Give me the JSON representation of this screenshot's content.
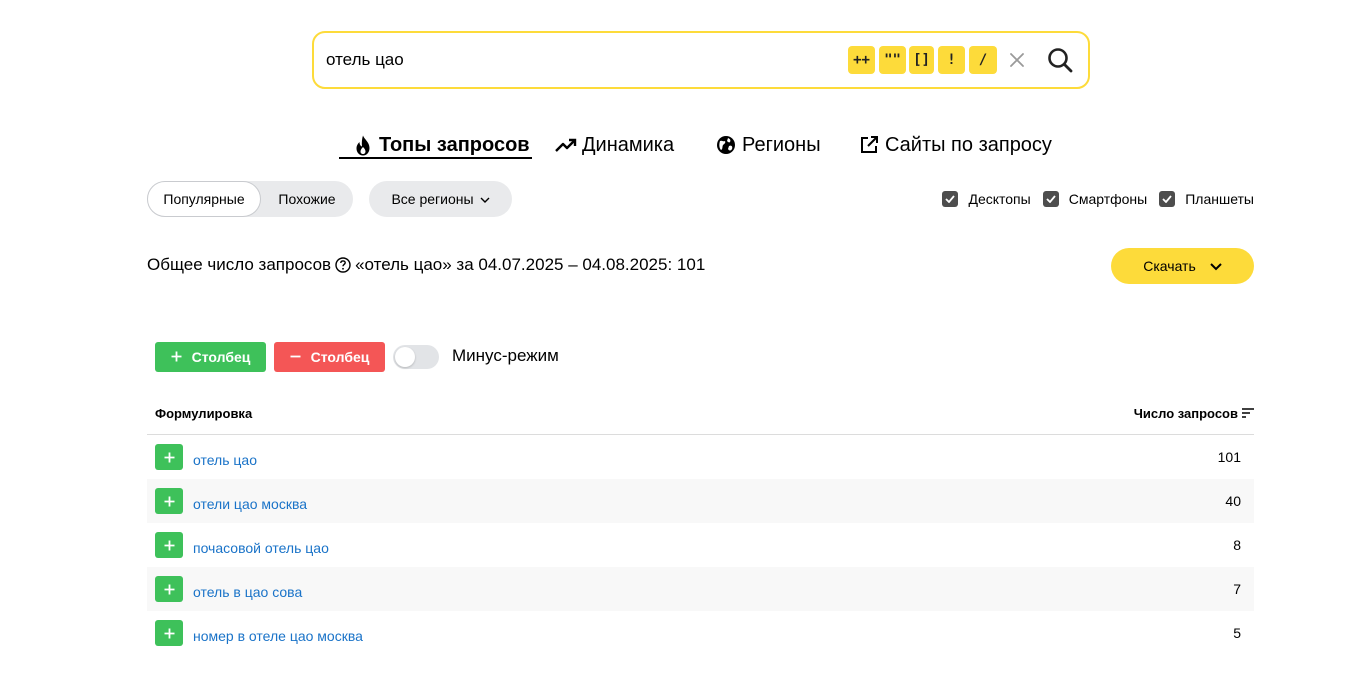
{
  "search": {
    "query": "отель цао",
    "operators": [
      "++",
      "\"\"",
      "[]",
      "!",
      "/"
    ]
  },
  "tabs": [
    {
      "label": "Топы запросов",
      "icon": "flame-icon",
      "active": true
    },
    {
      "label": "Динамика",
      "icon": "trend-up-icon",
      "active": false
    },
    {
      "label": "Регионы",
      "icon": "globe-icon",
      "active": false
    },
    {
      "label": "Сайты по запросу",
      "icon": "external-link-icon",
      "active": false
    }
  ],
  "filters": {
    "segment": [
      "Популярные",
      "Похожие"
    ],
    "regions_label": "Все регионы",
    "devices": [
      {
        "label": "Десктопы",
        "checked": true
      },
      {
        "label": "Смартфоны",
        "checked": true
      },
      {
        "label": "Планшеты",
        "checked": true
      }
    ]
  },
  "summary": {
    "prefix": "Общее число запросов",
    "suffix": "«отель цао» за 04.07.2025 – 04.08.2025: 101",
    "download_label": "Скачать"
  },
  "tools": {
    "add_column": "Столбец",
    "remove_column": "Столбец",
    "minus_mode": "Минус-режим"
  },
  "table": {
    "col_phrase": "Формулировка",
    "col_count": "Число запросов",
    "rows": [
      {
        "phrase": "отель цао",
        "count": "101"
      },
      {
        "phrase": "отели цао москва",
        "count": "40"
      },
      {
        "phrase": "почасовой отель цао",
        "count": "8"
      },
      {
        "phrase": "отель в цао сова",
        "count": "7"
      },
      {
        "phrase": "номер в отеле цао москва",
        "count": "5"
      }
    ]
  },
  "colors": {
    "accent_yellow": "#fddb3a",
    "green": "#3ec15a",
    "red": "#f45656",
    "link": "#1a73c8"
  }
}
